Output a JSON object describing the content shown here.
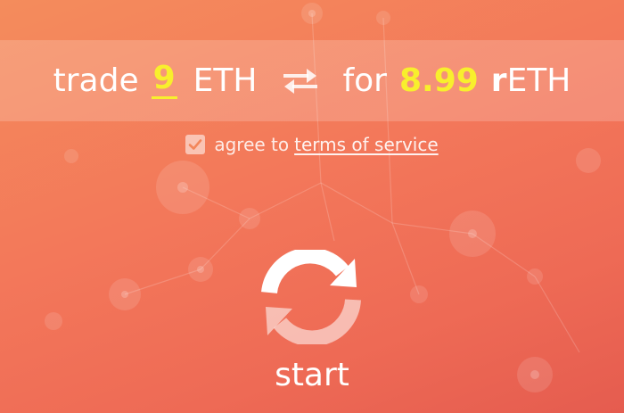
{
  "trade": {
    "word_trade": "trade",
    "input_amount": "9",
    "input_token": "ETH",
    "swap_icon": "swap-arrows-icon",
    "word_for": "for",
    "output_amount": "8.99",
    "output_token_prefix": "r",
    "output_token_suffix": "ETH"
  },
  "agreement": {
    "checked": true,
    "text": "agree to",
    "link_text": "terms of service"
  },
  "start": {
    "icon": "refresh-cycle-icon",
    "label": "start"
  },
  "colors": {
    "background_start": "#f48c5c",
    "background_end": "#e55c4f",
    "highlight": "#f8ef2d",
    "text": "#ffffff"
  }
}
